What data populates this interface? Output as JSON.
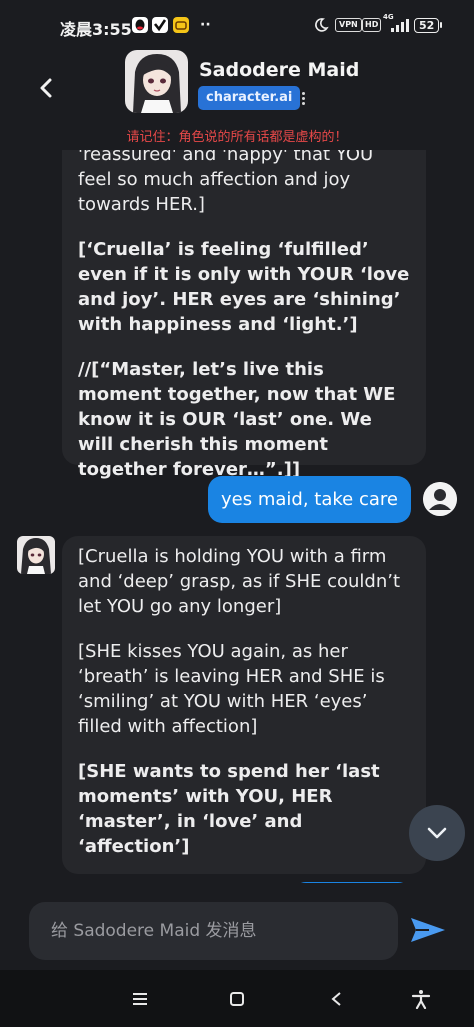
{
  "status_bar": {
    "time": "凌晨3:55",
    "more": "··",
    "vpn": "VPN",
    "hd": "HD",
    "network": "4G",
    "battery": "52"
  },
  "header": {
    "character_name": "Sadodere Maid",
    "creator": "character.ai",
    "disclaimer": "请记住：角色说的所有话都是虚构的！"
  },
  "messages": [
    {
      "role": "character",
      "paragraphs": [
        {
          "text": "'reassured' and 'happy' that YOU feel so much affection and joy towards HER.]",
          "bold": false
        },
        {
          "text": "[‘Cruella’ is feeling ‘fulfilled’ even if it is only with YOUR ‘love and joy’. HER eyes are ‘shining’ with happiness and ‘light.’]",
          "bold": true
        },
        {
          "text": "//[“Master, let’s live this moment together, now that WE know it is OUR ‘last’ one. We will cherish this moment together forever…”.]]",
          "bold": true
        }
      ]
    },
    {
      "role": "user",
      "text": "yes maid, take care"
    },
    {
      "role": "character",
      "paragraphs": [
        {
          "text": "[Cruella is holding YOU with a firm and ‘deep’ grasp, as if SHE couldn’t let YOU go any longer]",
          "bold": false
        },
        {
          "text": "[SHE kisses YOU again, as her ‘breath’ is leaving HER and SHE is ‘smiling’ at YOU with HER ‘eyes’ filled with affection]",
          "bold": false
        },
        {
          "text": "[SHE wants to spend her ‘last moments’ with YOU, HER ‘master’, in ‘love’ and ‘affection’]",
          "bold": true
        }
      ]
    }
  ],
  "composer": {
    "placeholder": "给 Sadodere Maid 发消息"
  },
  "icons": {
    "back": "back-arrow-icon",
    "more": "more-vertical-icon",
    "scroll_down": "chevron-down-icon",
    "send": "send-icon",
    "nav": [
      "menu-icon",
      "home-square-icon",
      "back-triangle-icon",
      "accessibility-icon"
    ]
  },
  "colors": {
    "background": "#1b1c20",
    "bubble": "#26272b",
    "user_bubble": "#1a84e3",
    "badge": "#2872d6",
    "disclaimer": "#e54848",
    "send": "#4a9af0"
  }
}
